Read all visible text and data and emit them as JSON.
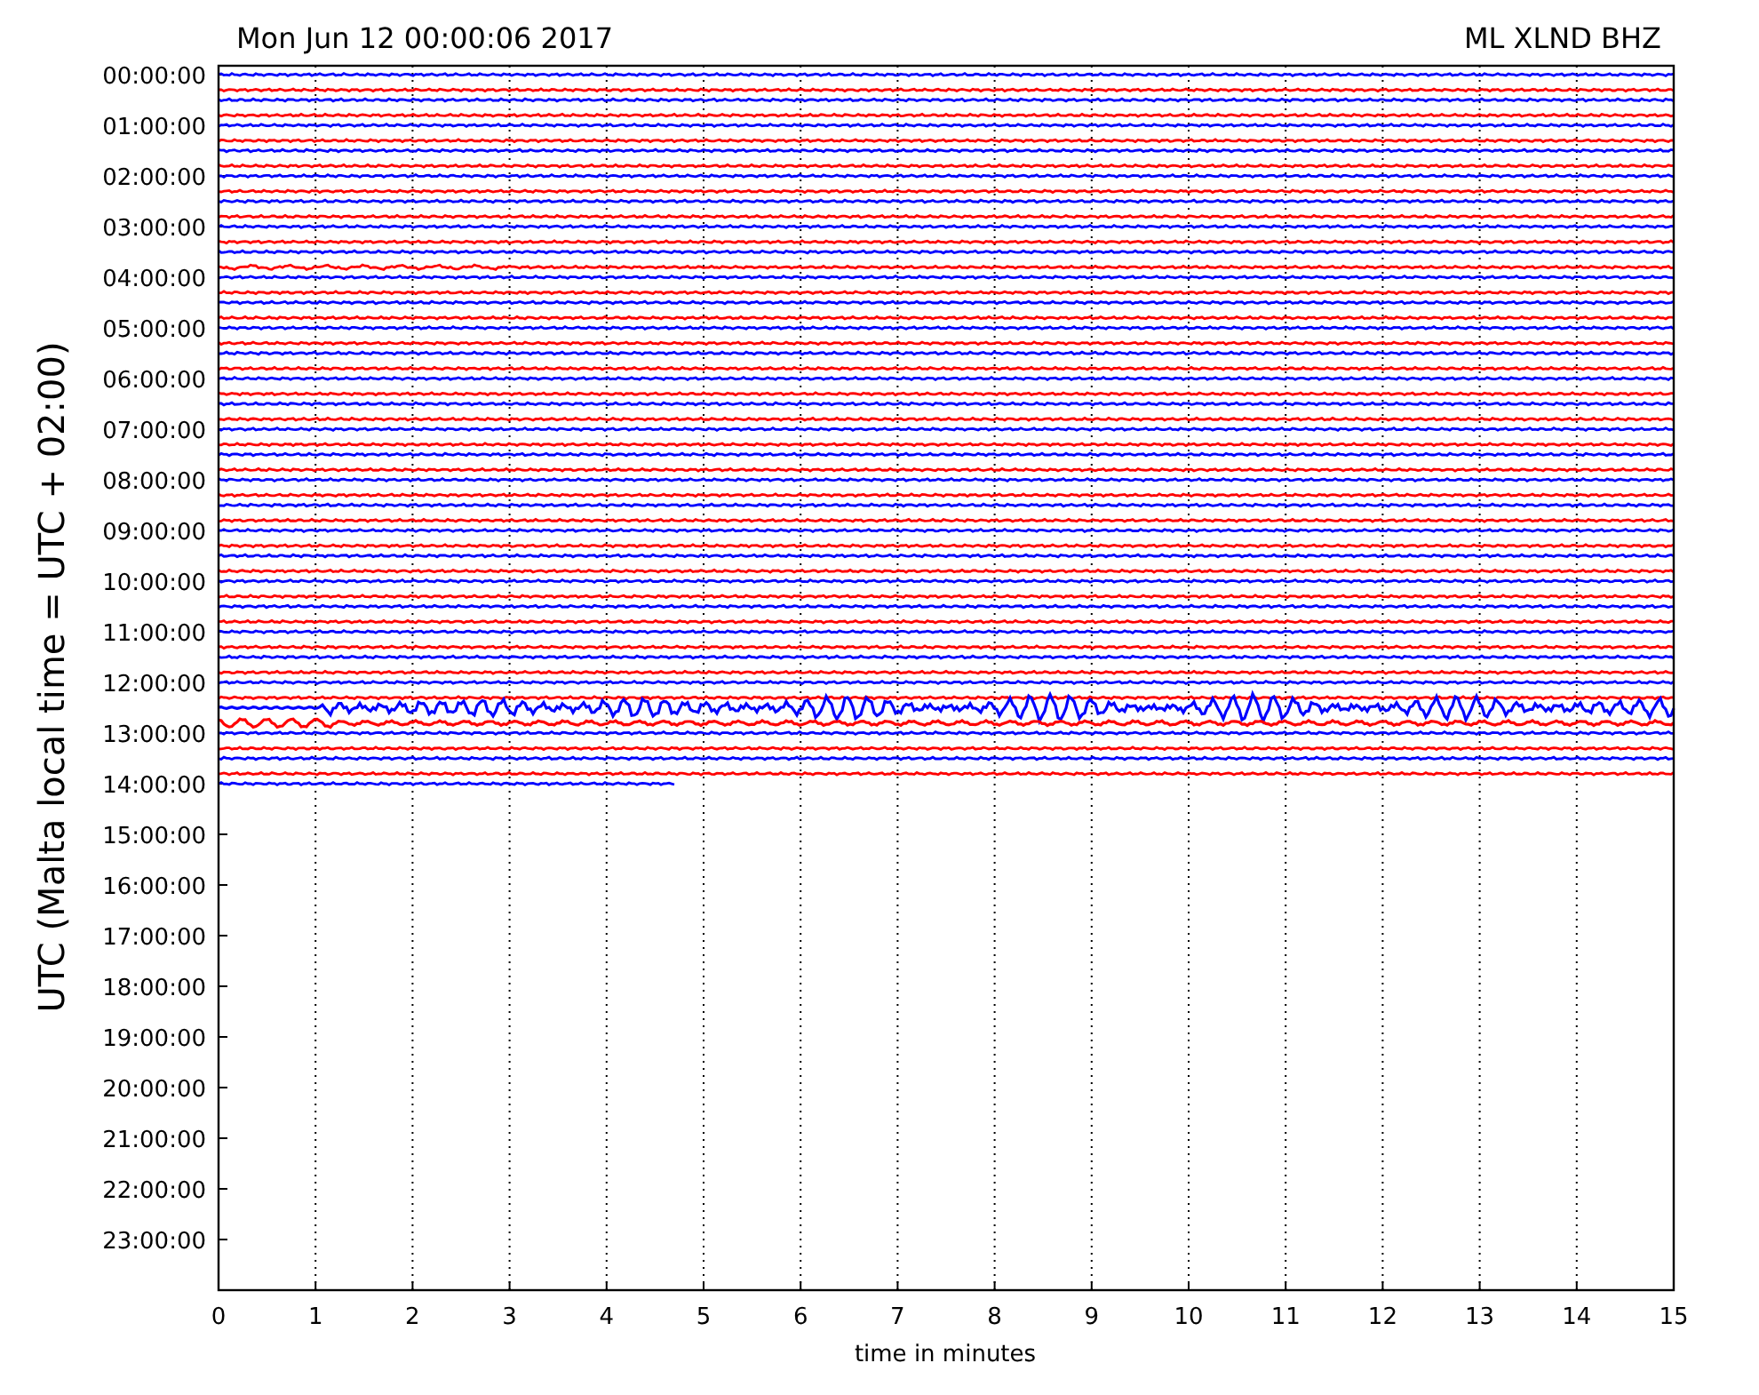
{
  "title_left": "Mon Jun 12 00:00:06 2017",
  "title_right": "ML XLND BHZ",
  "ylabel": "UTC (Malta local time = UTC + 02:00)",
  "xlabel": "time in minutes",
  "yticks": [
    "00:00:00",
    "01:00:00",
    "02:00:00",
    "03:00:00",
    "04:00:00",
    "05:00:00",
    "06:00:00",
    "07:00:00",
    "08:00:00",
    "09:00:00",
    "10:00:00",
    "11:00:00",
    "12:00:00",
    "13:00:00",
    "14:00:00",
    "15:00:00",
    "16:00:00",
    "17:00:00",
    "18:00:00",
    "19:00:00",
    "20:00:00",
    "21:00:00",
    "22:00:00",
    "23:00:00"
  ],
  "xticks": [
    "0",
    "1",
    "2",
    "3",
    "4",
    "5",
    "6",
    "7",
    "8",
    "9",
    "10",
    "11",
    "12",
    "13",
    "14",
    "15"
  ]
}
